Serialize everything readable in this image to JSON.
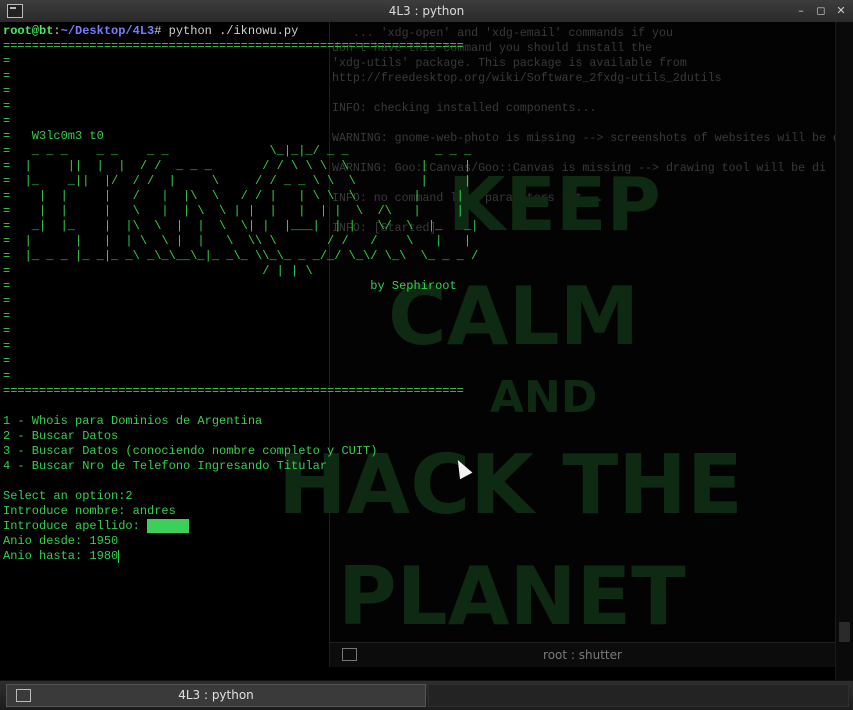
{
  "window": {
    "title": "4L3 : python",
    "buttons": [
      "–",
      "◻",
      "✕"
    ]
  },
  "terminal": {
    "prompt_user": "root@bt",
    "prompt_sep": ":",
    "prompt_path": "~/Desktop/4L3",
    "prompt_symbol": "#",
    "command": " python ./iknowu.py",
    "rule": "================================================================",
    "banner_lines": [
      "=",
      "=",
      "=",
      "=",
      "=",
      "=   W3lc0m3 t0",
      "=   _ _ _    _ _    _ _              \\_|_|_/ _ _            _ _ _",
      "=  |     ||  |  |  / /  _ _ _       / / \\ \\ \\  \\          |     |",
      "=  |_    _||  |/  / /  |     \\     / / _ _ \\ \\  \\         |     |",
      "=    |  |     |   /   |  |\\  \\   / / |   | \\ \\  \\        |     |",
      "=    |  |     |   \\   |  | \\  \\ | |  |   |  | |  \\  /\\   |     |",
      "=   _|  |_    |  |\\  \\  |  |  \\  \\| |  |___|  | |   \\/  \\  |_   _|",
      "=  |      |   |  | \\  \\ |  |   \\  \\\\ \\       / /   /    \\   |   |",
      "=  |_ _ _ |_ _|_ _\\ _\\_\\__\\_|_ _\\_ \\\\_\\_ _ _/_/ \\_\\/ \\_\\  \\_ _ _ /",
      "=                                   / | | \\",
      "=                                                  by Sephiroot",
      "=",
      "=",
      "=",
      "=",
      "=",
      "="
    ],
    "menu": [
      "1 - Whois para Dominios de Argentina",
      "2 - Buscar Datos",
      "3 - Buscar Datos (conociendo nombre completo y CUIT)",
      "4 - Buscar Nro de Telefono Ingresando Titular"
    ],
    "select_prompt": "Select an option:",
    "select_value": "2",
    "name_prompt": "Introduce nombre: ",
    "name_value": "andres",
    "surname_prompt": "Introduce apellido: ",
    "from_prompt": "Anio desde: ",
    "from_value": "1950",
    "to_prompt": "Anio hasta: ",
    "to_value": "1980"
  },
  "background_window": {
    "log_lines": [
      "   ... 'xdg-open' and 'xdg-email' commands if you",
      "don't have this command you should install the",
      "'xdg-utils' package. This package is available from",
      "http://freedesktop.org/wiki/Software_2fxdg-utils_2dutils",
      "",
      "INFO: checking installed components...",
      "",
      "WARNING: gnome-web-photo is missing --> screenshots of websites will be d",
      "",
      "WARNING: Goo::Canvas/Goo::Canvas is missing --> drawing tool will be di",
      "",
      "INFO: no command line parameters set...",
      "",
      "INFO: [Started]"
    ],
    "watermark": [
      "KEEP",
      "CALM",
      "AND",
      "HACK THE",
      "PLANET"
    ],
    "status_label": "root : shutter"
  },
  "taskbar": {
    "active_task": "4L3 : python"
  },
  "colors": {
    "terminal_green": "#35d04a",
    "path_blue": "#7b7bff",
    "watermark_green": "#0f2a12"
  }
}
